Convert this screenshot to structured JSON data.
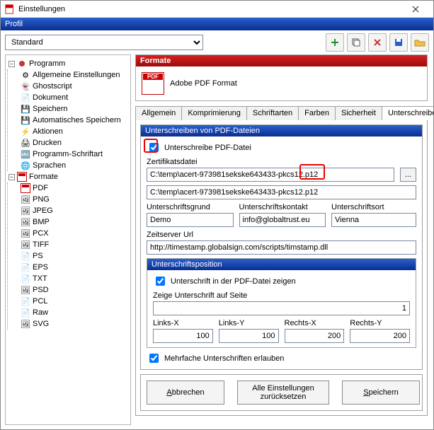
{
  "window": {
    "title": "Einstellungen"
  },
  "profile": {
    "label": "Profil",
    "selected": "Standard"
  },
  "toolbar_icons": {
    "add": "add-icon",
    "copy": "copy-icon",
    "delete": "delete-icon",
    "save": "save-icon",
    "open": "open-icon"
  },
  "tree": {
    "root1": {
      "label": "Programm",
      "children": [
        "Allgemeine Einstellungen",
        "Ghostscript",
        "Dokument",
        "Speichern",
        "Automatisches Speichern",
        "Aktionen",
        "Drucken",
        "Programm-Schriftart",
        "Sprachen"
      ]
    },
    "root2": {
      "label": "Formate",
      "children": [
        "PDF",
        "PNG",
        "JPEG",
        "BMP",
        "PCX",
        "TIFF",
        "PS",
        "EPS",
        "TXT",
        "PSD",
        "PCL",
        "Raw",
        "SVG"
      ]
    }
  },
  "format_panel": {
    "header": "Formate",
    "name": "Adobe PDF Format"
  },
  "tabs": {
    "items": [
      "Allgemein",
      "Komprimierung",
      "Schriftarten",
      "Farben",
      "Sicherheit",
      "Unterschreiben"
    ],
    "active": 5
  },
  "sign": {
    "group_header": "Unterschreiben von PDF-Dateien",
    "chk_sign": "Unterschreibe PDF-Datei",
    "cert_label": "Zertifikatsdatei",
    "cert_value": "C:\\temp\\acert-973981sekske643433-pkcs12.p12",
    "cert_echo": "C:\\temp\\acert-973981sekske643433-pkcs12.p12",
    "reason_label": "Unterschriftsgrund",
    "reason_value": "Demo",
    "contact_label": "Unterschriftskontakt",
    "contact_value": "info@globaltrust.eu",
    "location_label": "Unterschriftsort",
    "location_value": "Vienna",
    "ts_label": "Zeitserver Url",
    "ts_value": "http://timestamp.globalsign.com/scripts/timstamp.dll",
    "pos_header": "Unterschriftsposition",
    "chk_show": "Unterschrift in der PDF-Datei zeigen",
    "page_label": "Zeige Unterschrift auf Seite",
    "page_value": "1",
    "lx_label": "Links-X",
    "lx": "100",
    "ly_label": "Links-Y",
    "ly": "100",
    "rx_label": "Rechts-X",
    "rx": "200",
    "ry_label": "Rechts-Y",
    "ry": "200",
    "chk_multi": "Mehrfache Unterschriften erlauben"
  },
  "buttons": {
    "cancel": "Abbrechen",
    "reset": "Alle Einstellungen zurücksetzen",
    "save": "Speichern"
  }
}
